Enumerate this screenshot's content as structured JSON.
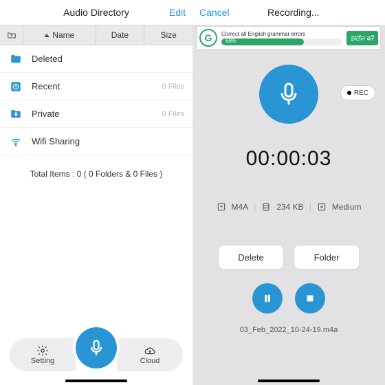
{
  "left": {
    "title": "Audio Directory",
    "edit": "Edit",
    "sort": {
      "name": "Name",
      "date": "Date",
      "size": "Size"
    },
    "rows": [
      {
        "name": "Deleted",
        "count": ""
      },
      {
        "name": "Recent",
        "count": "0 Files"
      },
      {
        "name": "Private",
        "count": "0 Files"
      },
      {
        "name": "Wifi Sharing",
        "count": ""
      }
    ],
    "total": "Total Items : 0 ( 0 Folders & 0 Files )",
    "dock": {
      "setting": "Setting",
      "cloud": "Cloud"
    }
  },
  "right": {
    "cancel": "Cancel",
    "title": "Recording...",
    "ad": {
      "heading": "Correct all English grammar errors",
      "pct": "68%",
      "cta": "इंस्टॉल करें"
    },
    "rec_label": "REC",
    "timer": "00:00:03",
    "meta": {
      "format": "M4A",
      "size": "234 KB",
      "quality": "Medium"
    },
    "buttons": {
      "delete": "Delete",
      "folder": "Folder"
    },
    "filename": "03_Feb_2022_10-24-19.m4a"
  },
  "colors": {
    "accent": "#2a95d5",
    "link": "#1a99e6",
    "green": "#2aa567"
  }
}
